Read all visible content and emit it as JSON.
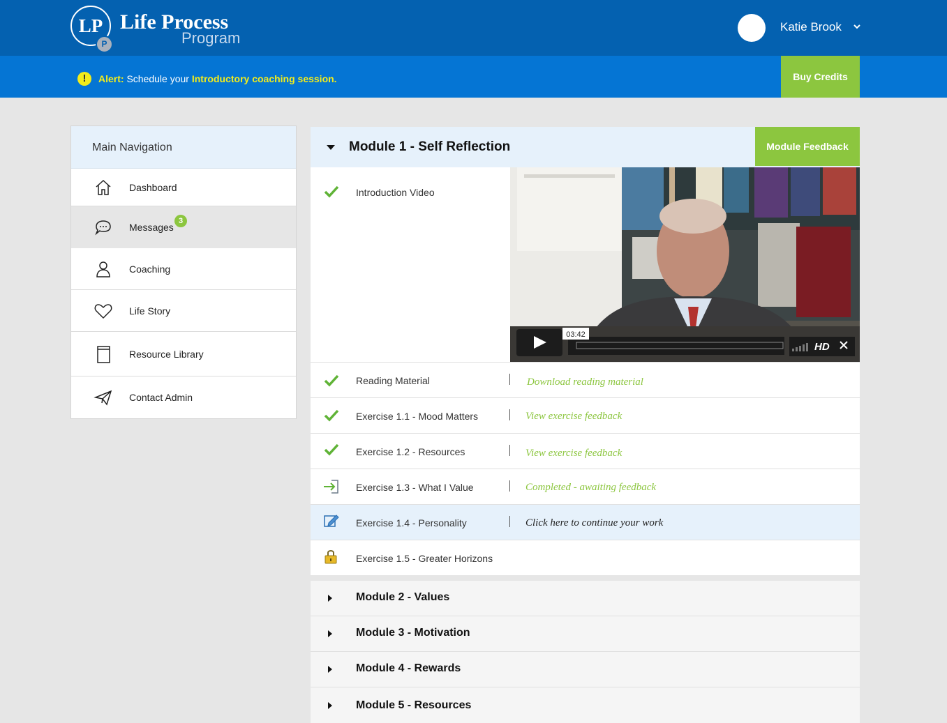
{
  "header": {
    "logo_initials": "LP",
    "logo_badge": "P",
    "logo_title": "Life Process",
    "logo_subtitle": "Program",
    "user_name": "Katie Brook"
  },
  "alert": {
    "label": "Alert:",
    "text": "Schedule your",
    "link": "Introductory coaching session.",
    "buy_credits": "Buy Credits"
  },
  "sidebar": {
    "title": "Main Navigation",
    "items": [
      {
        "label": "Dashboard",
        "icon": "home-icon"
      },
      {
        "label": "Messages",
        "icon": "chat-icon",
        "badge": "3"
      },
      {
        "label": "Coaching",
        "icon": "user-icon"
      },
      {
        "label": "Life Story",
        "icon": "heart-icon"
      },
      {
        "label": "Resource Library",
        "icon": "book-icon"
      },
      {
        "label": "Contact Admin",
        "icon": "send-icon"
      }
    ]
  },
  "module1": {
    "title": "Module 1 - Self Reflection",
    "feedback_button": "Module Feedback",
    "video": {
      "time": "03:42",
      "quality": "HD"
    },
    "items": [
      {
        "label": "Introduction Video",
        "status": "complete",
        "link": ""
      },
      {
        "label": "Reading Material",
        "status": "complete",
        "link": "Download reading material"
      },
      {
        "label": "Exercise 1.1 - Mood Matters",
        "status": "complete",
        "link": "View exercise feedback"
      },
      {
        "label": "Exercise 1.2 - Resources",
        "status": "complete",
        "link": "View exercise feedback"
      },
      {
        "label": "Exercise 1.3 - What I Value",
        "status": "submitted",
        "link": "Completed - awaiting feedback"
      },
      {
        "label": "Exercise 1.4 - Personality",
        "status": "in-progress",
        "link": "Click here to continue your work"
      },
      {
        "label": "Exercise 1.5 - Greater Horizons",
        "status": "locked",
        "link": ""
      }
    ]
  },
  "modules": [
    {
      "title": "Module 2 - Values"
    },
    {
      "title": "Module 3 - Motivation"
    },
    {
      "title": "Module 4 - Rewards"
    },
    {
      "title": "Module 5 - Resources"
    }
  ],
  "colors": {
    "brand": "#0461b0",
    "alert_bar": "#0575d4",
    "accent_green": "#8cc63f",
    "alert_yellow": "#f2ec1b",
    "highlight": "#e6f1fb"
  }
}
